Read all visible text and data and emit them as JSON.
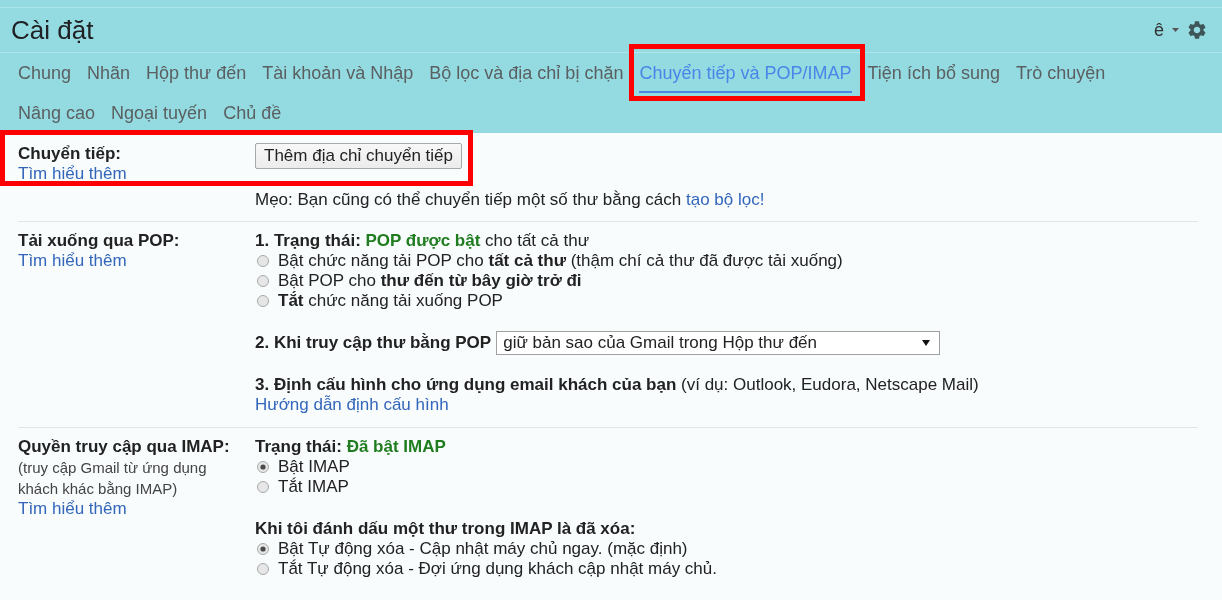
{
  "header": {
    "title": "Cài đặt",
    "input_tool": "ê"
  },
  "tabs": [
    {
      "label": "Chung",
      "selected": false,
      "highlighted": false
    },
    {
      "label": "Nhãn",
      "selected": false,
      "highlighted": false
    },
    {
      "label": "Hộp thư đến",
      "selected": false,
      "highlighted": false
    },
    {
      "label": "Tài khoản và Nhập",
      "selected": false,
      "highlighted": false
    },
    {
      "label": "Bộ lọc và địa chỉ bị chặn",
      "selected": false,
      "highlighted": false
    },
    {
      "label": "Chuyển tiếp và POP/IMAP",
      "selected": true,
      "highlighted": true
    },
    {
      "label": "Tiện ích bổ sung",
      "selected": false,
      "highlighted": false
    },
    {
      "label": "Trò chuyện",
      "selected": false,
      "highlighted": false
    },
    {
      "label": "Nâng cao",
      "selected": false,
      "highlighted": false
    },
    {
      "label": "Ngoại tuyến",
      "selected": false,
      "highlighted": false
    },
    {
      "label": "Chủ đề",
      "selected": false,
      "highlighted": false
    }
  ],
  "sections": [
    {
      "label": "Chuyển tiếp:",
      "link": "Tìm hiểu thêm",
      "highlighted": true,
      "blocks": [
        {
          "kind": "button",
          "label": "Thêm địa chỉ chuyển tiếp"
        },
        {
          "kind": "tip",
          "text": "Mẹo: Bạn cũng có thể chuyển tiếp một số thư bằng cách",
          "link": "tạo bộ lọc!"
        }
      ]
    },
    {
      "label": "Tải xuống qua POP:",
      "link": "Tìm hiểu thêm",
      "highlighted": false,
      "blocks": [
        {
          "kind": "status",
          "label": "1. Trạng thái:",
          "value": "POP được bật",
          "rest": "cho tất cả thư"
        },
        {
          "kind": "radios",
          "options": [
            {
              "text": "Bật chức năng tải POP cho **tất cả thư** (thậm chí cả thư đã được tải xuống)",
              "selected": false
            },
            {
              "text": "Bật POP cho **thư đến từ bây giờ trở đi**",
              "selected": false
            },
            {
              "text": "**Tắt** chức năng tải xuống POP",
              "selected": false
            }
          ]
        },
        {
          "kind": "select",
          "label": "2. Khi truy cập thư bằng POP",
          "value": "giữ bản sao của Gmail trong Hộp thư đến"
        },
        {
          "kind": "text",
          "text": "**3. Định cấu hình cho ứng dụng email khách của bạn** (ví dụ: Outlook, Eudora, Netscape Mail)"
        },
        {
          "kind": "link",
          "text": "Hướng dẫn định cấu hình"
        }
      ]
    },
    {
      "label": "Quyền truy cập qua IMAP:",
      "note": "(truy cập Gmail từ ứng dụng khách khác bằng IMAP)",
      "link": "Tìm hiểu thêm",
      "highlighted": false,
      "blocks": [
        {
          "kind": "status",
          "label": "Trạng thái:",
          "value": "Đã bật IMAP"
        },
        {
          "kind": "radios",
          "options": [
            {
              "text": "Bật IMAP",
              "selected": true
            },
            {
              "text": "Tắt IMAP",
              "selected": false
            }
          ]
        },
        {
          "kind": "heading",
          "text": "Khi tôi đánh dấu một thư trong IMAP là đã xóa:"
        },
        {
          "kind": "radios",
          "options": [
            {
              "text": "Bật Tự động xóa - Cập nhật máy chủ ngay. (mặc định)",
              "selected": true
            },
            {
              "text": "Tắt Tự động xóa - Đợi ứng dụng khách cập nhật máy chủ.",
              "selected": false
            }
          ]
        }
      ]
    }
  ]
}
